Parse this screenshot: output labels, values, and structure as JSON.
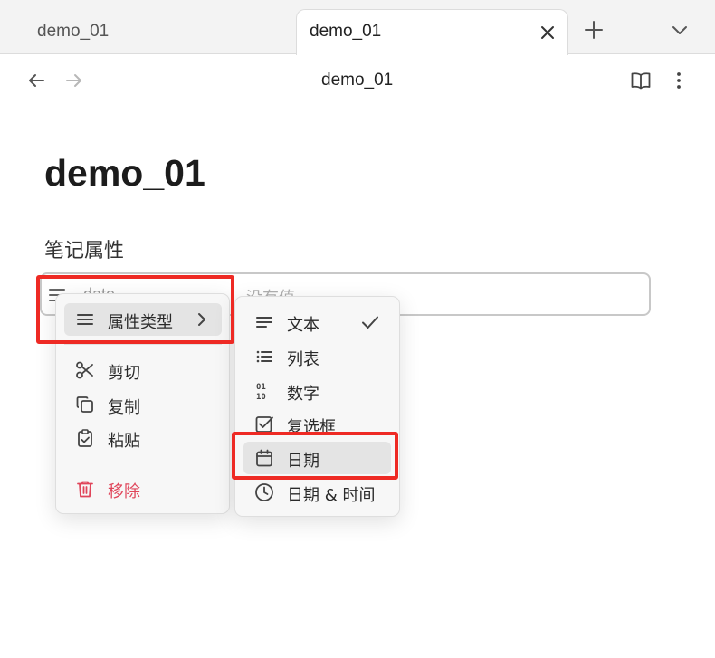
{
  "tabs": [
    {
      "label": "demo_01",
      "active": false
    },
    {
      "label": "demo_01",
      "active": true
    }
  ],
  "nav": {
    "title": "demo_01"
  },
  "note": {
    "title": "demo_01",
    "properties_heading": "笔记属性",
    "property": {
      "key": "date",
      "value_placeholder": "没有值"
    }
  },
  "context_menu": {
    "items": [
      {
        "label": "属性类型",
        "icon": "menu-lines-icon",
        "has_submenu": true
      },
      {
        "label": "剪切",
        "icon": "scissors-icon"
      },
      {
        "label": "复制",
        "icon": "copy-icon"
      },
      {
        "label": "粘贴",
        "icon": "clipboard-icon"
      },
      {
        "label": "移除",
        "icon": "trash-icon",
        "danger": true
      }
    ]
  },
  "type_submenu": {
    "items": [
      {
        "label": "文本",
        "icon": "text-lines-icon",
        "checked": true
      },
      {
        "label": "列表",
        "icon": "list-icon"
      },
      {
        "label": "数字",
        "icon": "binary-icon"
      },
      {
        "label": "复选框",
        "icon": "checkbox-icon"
      },
      {
        "label": "日期",
        "icon": "calendar-icon",
        "highlighted": true
      },
      {
        "label": "日期 & 时间",
        "icon": "clock-icon"
      }
    ]
  },
  "colors": {
    "danger": "#e0455a",
    "highlight_box": "#ee2a24",
    "hover": "#e4e4e4"
  }
}
